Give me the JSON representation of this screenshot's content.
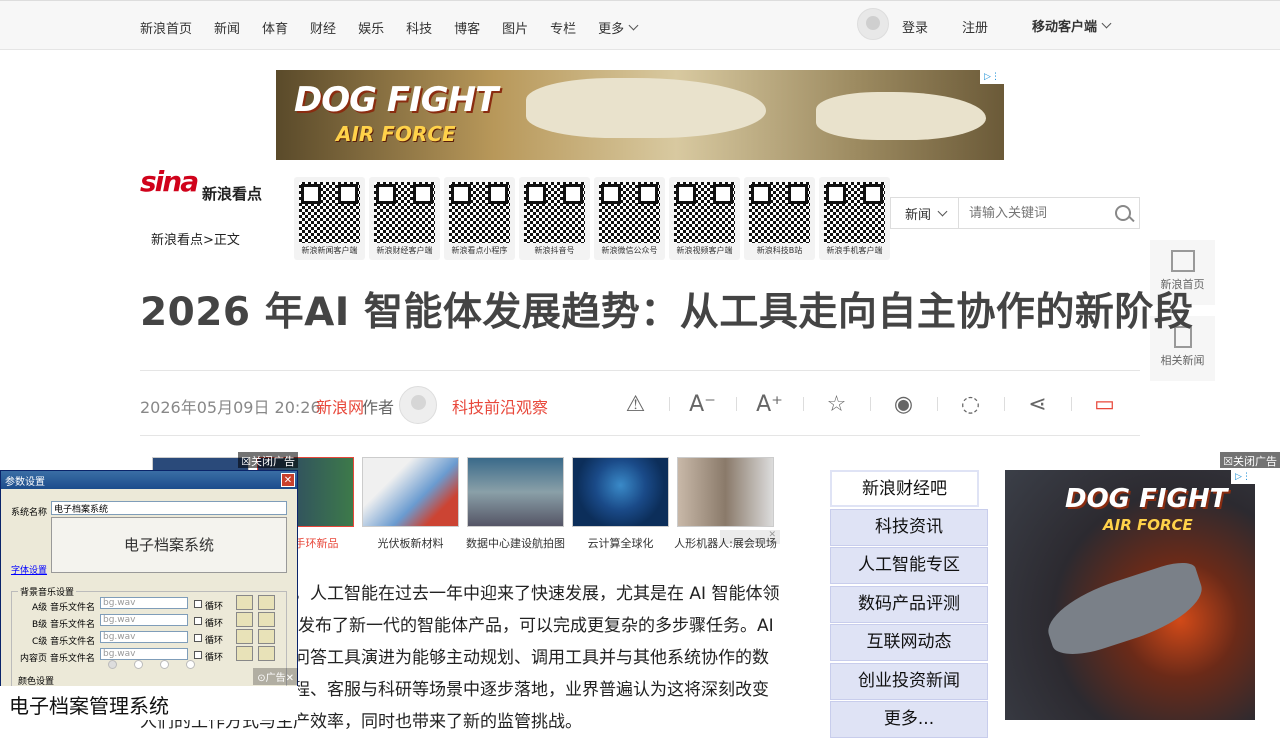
{
  "topnav": {
    "items": [
      "新浪首页",
      "新闻",
      "体育",
      "财经",
      "娱乐",
      "科技",
      "博客",
      "图片",
      "专栏"
    ],
    "more": "更多",
    "login": "登录",
    "register": "注册",
    "mobile": "移动客户端"
  },
  "ad_top": {
    "headline": "DOG FIGHT",
    "subline": "AIR FORCE"
  },
  "logo": {
    "text": "sina",
    "product": "新浪看点"
  },
  "breadcrumb": "新浪看点>正文",
  "qr_codes": [
    "新浪新闻客户端",
    "新浪财经客户端",
    "新浪看点小程序",
    "新浪抖音号",
    "新浪微信公众号",
    "新浪视频客户端",
    "新浪科技B站",
    "新浪手机客户端"
  ],
  "search": {
    "scope": "新闻",
    "placeholder": "请输入关键词"
  },
  "side": {
    "home": "新浪首页",
    "related": "相关新闻"
  },
  "article": {
    "title": "2026 年AI 智能体发展趋势：从工具走向自主协作的新阶段",
    "date": "2026年05月09日 20:26",
    "source": "新浪网",
    "author_label": "作者",
    "author": "科技前沿观察"
  },
  "tools": [
    "⚠",
    "A⁻",
    "A⁺",
    "☆",
    "weibo",
    "wechat",
    "share",
    "comment"
  ],
  "thumbs": [
    {
      "caption": ""
    },
    {
      "caption": "智能手环新品"
    },
    {
      "caption": "光伏板新材料"
    },
    {
      "caption": "数据中心建设航拍图"
    },
    {
      "caption": "云计算全球化"
    },
    {
      "caption": "人形机器人:展会现场"
    }
  ],
  "body_text": "据最新行业报告显示，人工智能在过去一年中迎来了快速发展，尤其是在 AI 智能体领域。多家AI 公司陆续发布了新一代的智能体产品，可以完成更复杂的多步骤任务。AI 智能体正在从单纯的问答工具演进为能够主动规划、调用工具并与其他系统协作的数字助手，在办公、编程、客服与科研等场景中逐步落地，业界普遍认为这将深刻改变人们的工作方式与生产效率，同时也带来了新的监管挑战。",
  "float_left": {
    "close": "关闭广告",
    "window_title": "参数设置",
    "sys_name_label": "系统名称",
    "sys_name_value": "电子档案系统",
    "big_text": "电子档案系统",
    "font_link": "字体设置",
    "group_label": "背景音乐设置",
    "rows": [
      {
        "label": "A级  音乐文件名",
        "value": "bg.wav"
      },
      {
        "label": "B级  音乐文件名",
        "value": "bg.wav"
      },
      {
        "label": "C级  音乐文件名",
        "value": "bg.wav"
      },
      {
        "label": "内容页  音乐文件名",
        "value": "bg.wav"
      }
    ],
    "loop": "循环",
    "color_label": "颜色设置",
    "caption": "电子档案管理系统",
    "ad_label": "广告"
  },
  "right_list": [
    "新浪财经吧",
    "科技资讯",
    "人工智能专区",
    "数码产品评测",
    "互联网动态",
    "创业投资新闻",
    "更多..."
  ],
  "float_right": {
    "close": "关闭广告",
    "headline": "DOG FIGHT",
    "subline": "AIR FORCE"
  }
}
